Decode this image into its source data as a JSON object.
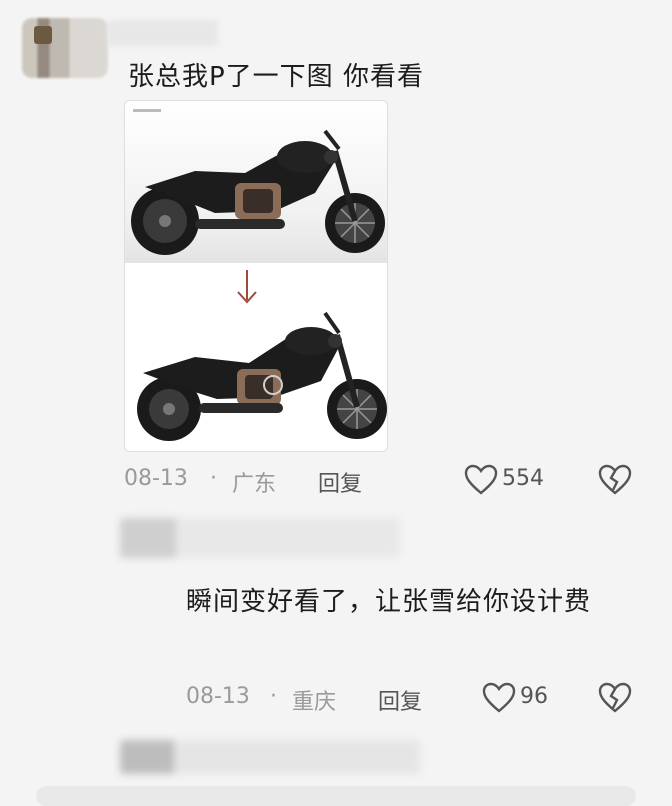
{
  "comment1": {
    "text": "张总我P了一下图 你看看",
    "date": "08-13",
    "separator": "·",
    "location": "广东",
    "reply_label": "回复",
    "like_count": "554"
  },
  "comment2": {
    "text": "瞬间变好看了，让张雪给你设计费",
    "date": "08-13",
    "separator": "·",
    "location": "重庆",
    "reply_label": "回复",
    "like_count": "96"
  },
  "icons": {
    "like": "heart-outline-icon",
    "dislike": "broken-heart-icon",
    "arrow": "arrow-down-icon"
  },
  "colors": {
    "meta": "#9a9a9a",
    "arrow": "#a04a3a",
    "bike": "#1a1a1a"
  }
}
